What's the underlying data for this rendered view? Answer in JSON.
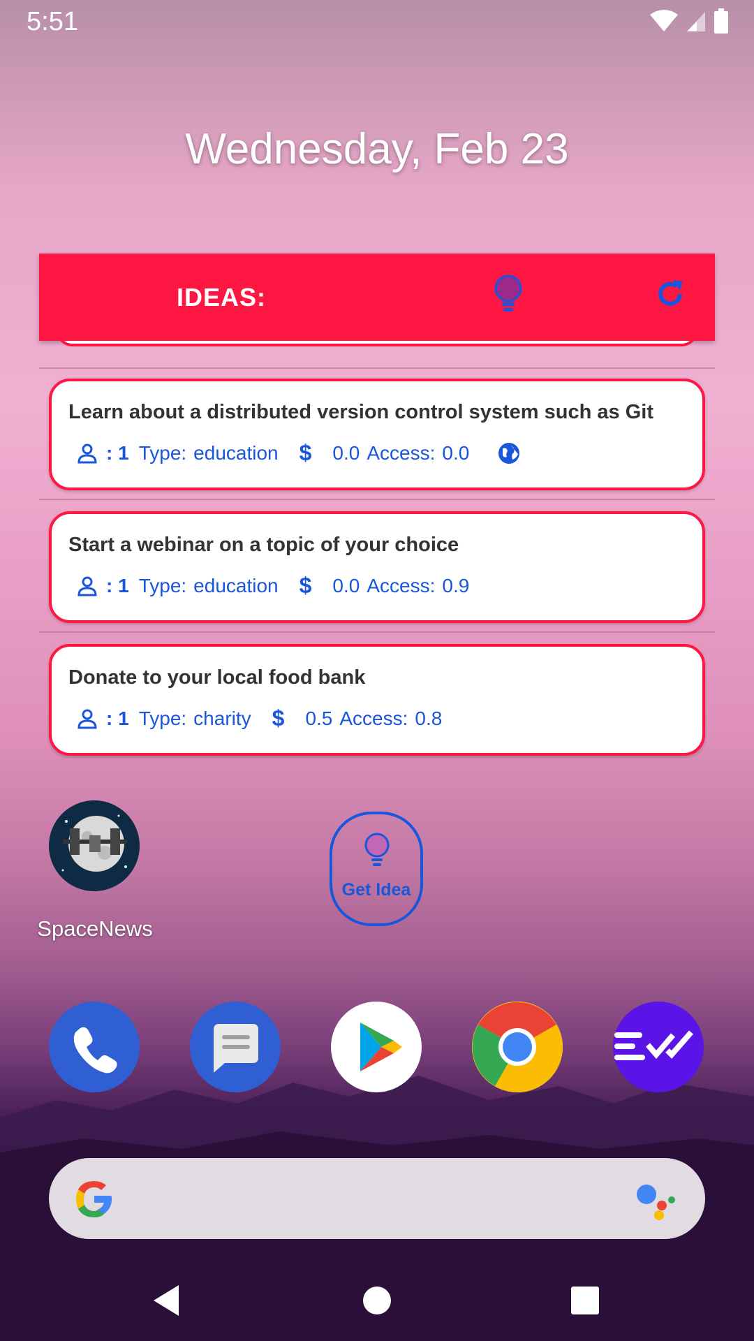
{
  "status_bar": {
    "time": "5:51"
  },
  "date": "Wednesday, Feb 23",
  "widget": {
    "title": "IDEAS:",
    "header_icons": [
      "bulb-icon",
      "refresh-icon"
    ],
    "ideas": [
      {
        "activity": "Learn about a distributed version control system such as Git",
        "participants": ": 1",
        "type_label": "Type:",
        "type": "education",
        "price": "0.0",
        "access_label": "Access:",
        "accessibility": "0.0",
        "has_link": true
      },
      {
        "activity": "Start a webinar on a topic of your choice",
        "participants": ": 1",
        "type_label": "Type:",
        "type": "education",
        "price": "0.0",
        "access_label": "Access:",
        "accessibility": "0.9",
        "has_link": false
      },
      {
        "activity": "Donate to your local food bank",
        "participants": ": 1",
        "type_label": "Type:",
        "type": "charity",
        "price": "0.5",
        "access_label": "Access:",
        "accessibility": "0.8",
        "has_link": false
      }
    ]
  },
  "home_apps": {
    "space_news_label": "SpaceNews"
  },
  "get_idea": {
    "label": "Get Idea"
  },
  "dock": [
    "phone-icon",
    "messages-icon",
    "play-store-icon",
    "chrome-icon",
    "tasks-app-icon"
  ],
  "colors": {
    "accent": "#ff1744",
    "blue": "#1a56db"
  }
}
